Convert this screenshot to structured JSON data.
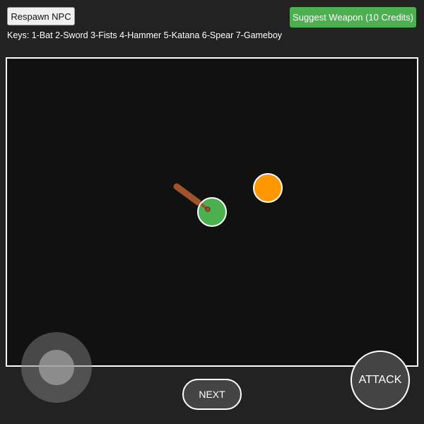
{
  "toolbar": {
    "respawn_label": "Respawn NPC",
    "suggest_label": "Suggest Weapon (10 Credits)"
  },
  "keys_hint": "Keys: 1-Bat 2-Sword 3-Fists 4-Hammer 5-Katana 6-Spear 7-Gameboy",
  "controls": {
    "next_label": "NEXT",
    "attack_label": "ATTACK"
  },
  "colors": {
    "player": "#4caf50",
    "npc": "#ff9800",
    "weapon_bat": "#a0522d",
    "accent_green": "#4caf50"
  },
  "game": {
    "equipped_weapon": "bat"
  }
}
